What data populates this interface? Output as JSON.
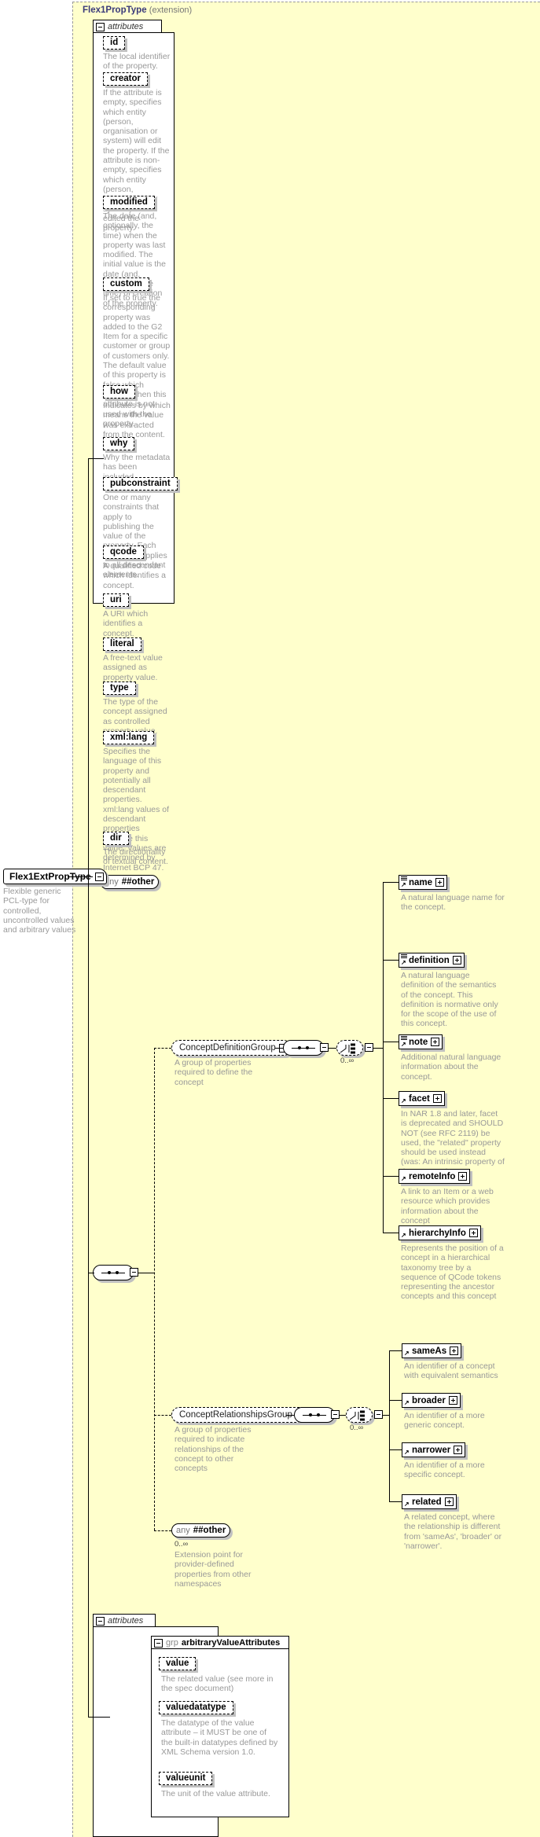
{
  "diagram": {
    "title": "Flex1PropType",
    "title_suffix": "(extension)",
    "attributes_label": "attributes",
    "group_keyword": "grp",
    "group_name": "arbitraryValueAttributes",
    "any_label": "any",
    "any_namespace": "##other",
    "cardinality": "0..∞",
    "type_box": {
      "name": "Flex1ExtPropType",
      "description": "Flexible generic PCL-type for controlled, uncontrolled values and arbitrary values"
    }
  },
  "attributes": [
    {
      "name": "id",
      "desc": "The local identifier of the property."
    },
    {
      "name": "creator",
      "desc": "If the attribute is empty, specifies which entity (person, organisation or system) will edit the property. If the attribute is non-empty, specifies which entity (person, organisation or system) has edited the property."
    },
    {
      "name": "modified",
      "desc": "The date (and, optionally, the time) when the property was last modified. The initial value is the date (and, optionally, the time) of creation of the property."
    },
    {
      "name": "custom",
      "desc": "If set to true the corresponding property was added to the G2 Item for a specific customer or group of customers only. The default value of this property is false which applies when this attribute is not used with the property."
    },
    {
      "name": "how",
      "desc": "Indicates by which means the value was extracted from the content."
    },
    {
      "name": "why",
      "desc": "Why the metadata has been included."
    },
    {
      "name": "pubconstraint",
      "desc": "One or many constraints that apply to publishing the value of the property. Each constraint applies to all descendant elements."
    },
    {
      "name": "qcode",
      "desc": "A qualified code which identifies a concept."
    },
    {
      "name": "uri",
      "desc": "A URI which identifies a concept."
    },
    {
      "name": "literal",
      "desc": "A free-text value assigned as property value."
    },
    {
      "name": "type",
      "desc": "The type of the concept assigned as controlled property value."
    },
    {
      "name": "xml:lang",
      "desc": "Specifies the language of this property and potentially all descendant properties. xml:lang values of descendant properties override this value. Values are determined by Internet BCP 47."
    },
    {
      "name": "dir",
      "desc": "The directionality of textual content."
    }
  ],
  "concept_definition_group": {
    "label": "ConceptDefinitionGroup",
    "desc": "A group of properties required to define the concept",
    "cardinality": "0..∞",
    "elements": [
      {
        "name": "name",
        "desc": "A natural language name for the concept."
      },
      {
        "name": "definition",
        "desc": "A natural language definition of the semantics of the concept. This definition is normative only for the scope of the use of this concept."
      },
      {
        "name": "note",
        "desc": "Additional natural language information about the concept."
      },
      {
        "name": "facet",
        "desc": "In NAR 1.8 and later, facet is deprecated and SHOULD NOT (see RFC 2119) be used, the \"related\" property should be used instead (was: An intrinsic property of the concept.)"
      },
      {
        "name": "remoteInfo",
        "desc": "A link to an Item or a web resource which provides information about the concept"
      },
      {
        "name": "hierarchyInfo",
        "desc": "Represents the position of a concept in a hierarchical taxonomy tree by a sequence of QCode tokens representing the ancestor concepts and this concept"
      }
    ]
  },
  "concept_relationships_group": {
    "label": "ConceptRelationshipsGroup",
    "desc": "A group of properties required to indicate relationships of the concept to other concepts",
    "cardinality": "0..∞",
    "elements": [
      {
        "name": "sameAs",
        "desc": "An identifier of a concept with equivalent semantics"
      },
      {
        "name": "broader",
        "desc": "An identifier of a more generic concept."
      },
      {
        "name": "narrower",
        "desc": "An identifier of a more specific concept."
      },
      {
        "name": "related",
        "desc": "A related concept, where the relationship is different from 'sameAs', 'broader' or 'narrower'."
      }
    ]
  },
  "any_other": {
    "label": "any",
    "namespace": "##other",
    "cardinality": "0..∞",
    "desc": "Extension point for provider-defined properties from other namespaces"
  },
  "value_attributes": [
    {
      "name": "value",
      "desc": "The related value (see more in the spec document)"
    },
    {
      "name": "valuedatatype",
      "desc": "The datatype of the value attribute – it MUST be one of the built-in datatypes defined by XML Schema version 1.0."
    },
    {
      "name": "valueunit",
      "desc": "The unit of the value attribute."
    }
  ],
  "colors": {
    "panel": "#ffffcc",
    "title": "#3a3a7a",
    "description": "#999999",
    "shadow": "#c0c0c0"
  }
}
